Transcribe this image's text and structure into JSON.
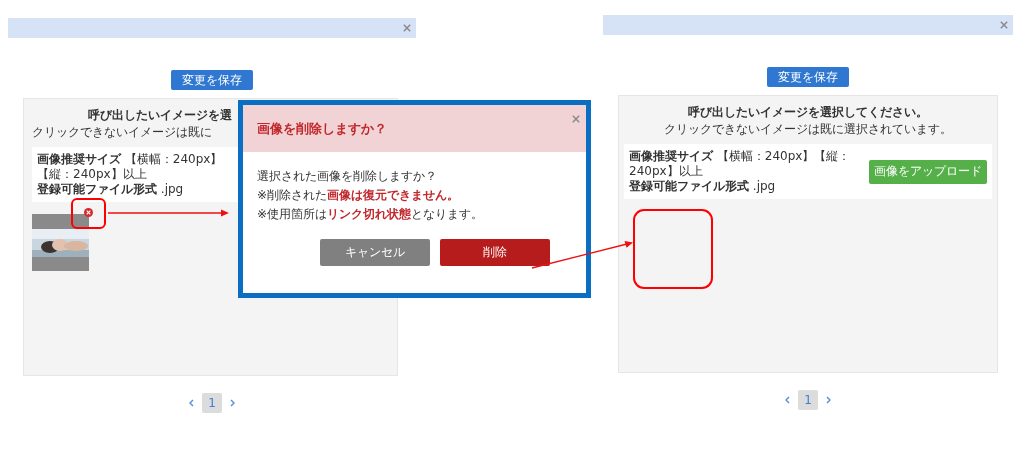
{
  "panels": [
    {
      "save_button": "変更を保存",
      "title": "呼び出したいイメージを選",
      "subtitle": "クリックできないイメージは既に",
      "size_note": "**画像推奨サイズ** 【横幅：240px】【縦：240px】以上",
      "format_note": "**登録可能ファイル形式** .jpg",
      "images": [
        {
          "kind": "picture"
        }
      ],
      "pages": [
        {
          "label": "1",
          "selected": true
        }
      ]
    },
    {
      "save_button": "変更を保存",
      "title": "呼び出したいイメージを選択してください。",
      "subtitle": "クリックできないイメージは既に選択されています。",
      "size_note": "**画像推奨サイズ** 【横幅：240px】【縦：240px】以上",
      "format_note": "**登録可能ファイル形式** .jpg",
      "upload_button": "画像をアップロード",
      "pages": [
        {
          "label": "1",
          "selected": true
        }
      ]
    }
  ],
  "dialog": {
    "title": "画像を削除しますか？",
    "lines": [
      "選択された画像を削除しますか？",
      "※削除された**画像は復元できません。**",
      "※使用箇所は**リンク切れ状態**となります。"
    ],
    "cancel_button": "キャンセル",
    "delete_button": "削除"
  }
}
